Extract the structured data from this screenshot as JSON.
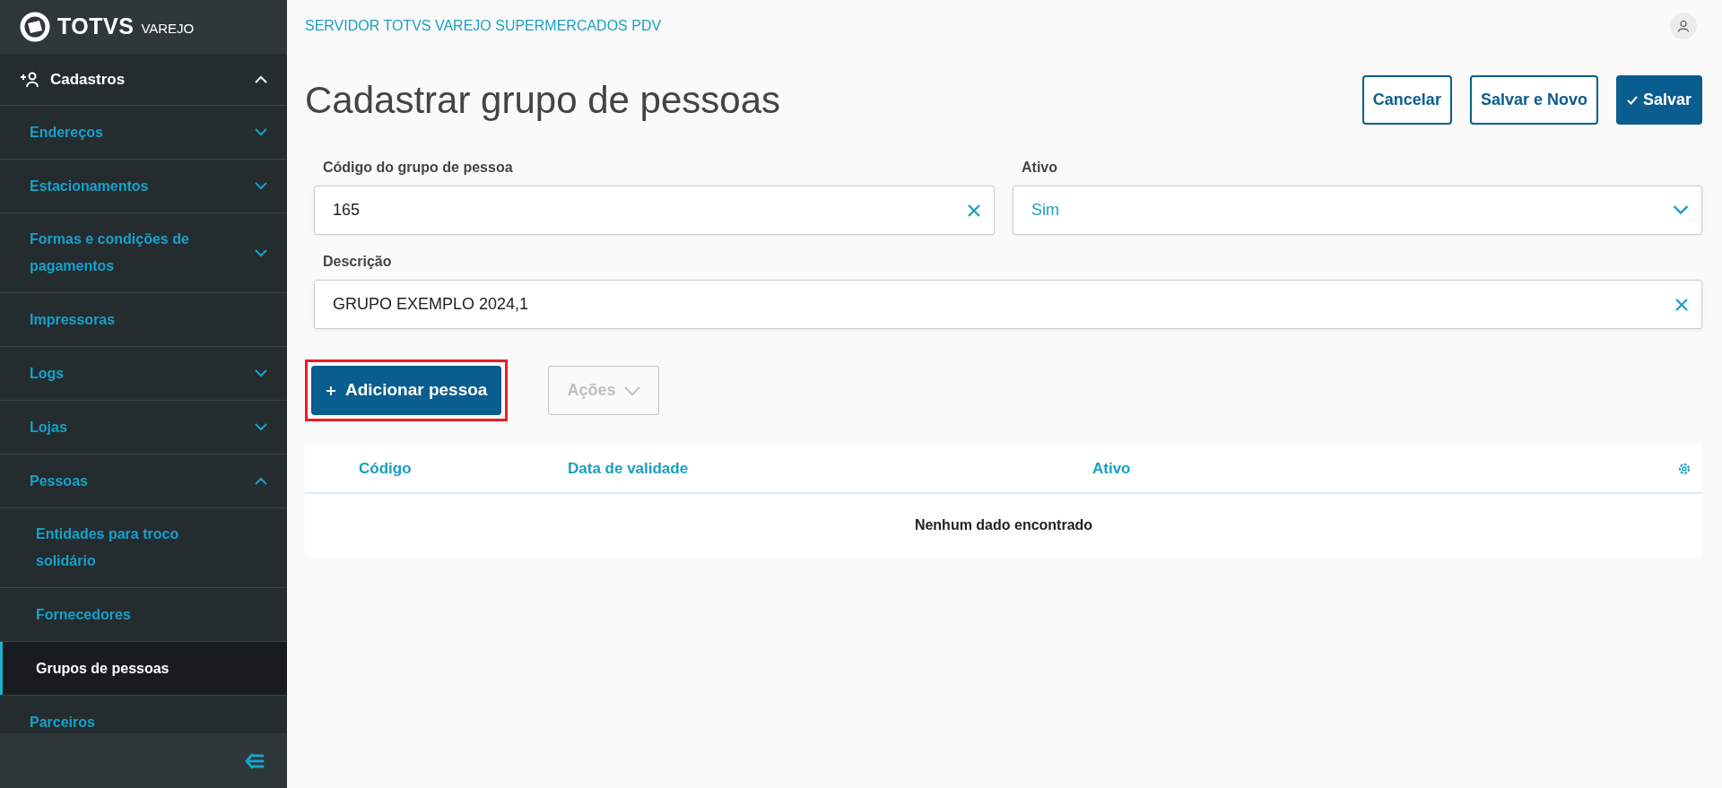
{
  "brand": {
    "name": "TOTVS",
    "product": "VAREJO"
  },
  "sidebar": {
    "section": {
      "label": "Cadastros",
      "expanded": true
    },
    "items": [
      {
        "label": "Endereços",
        "kind": "group",
        "expanded": false,
        "selected": false
      },
      {
        "label": "Estacionamentos",
        "kind": "group",
        "expanded": false,
        "selected": false
      },
      {
        "label": "Formas e condições de pagamentos",
        "kind": "group",
        "expanded": false,
        "selected": false
      },
      {
        "label": "Impressoras",
        "kind": "link",
        "selected": false
      },
      {
        "label": "Logs",
        "kind": "group",
        "expanded": false,
        "selected": false
      },
      {
        "label": "Lojas",
        "kind": "group",
        "expanded": false,
        "selected": false
      },
      {
        "label": "Pessoas",
        "kind": "group",
        "expanded": true,
        "selected": false,
        "children": [
          {
            "label": "Entidades para troco solidário",
            "selected": false
          },
          {
            "label": "Fornecedores",
            "selected": false
          },
          {
            "label": "Grupos de pessoas",
            "selected": true
          }
        ]
      },
      {
        "label": "Parceiros",
        "kind": "link",
        "selected": false
      }
    ]
  },
  "header": {
    "title": "SERVIDOR TOTVS VAREJO SUPERMERCADOS PDV"
  },
  "page": {
    "title": "Cadastrar grupo de pessoas",
    "actions": [
      {
        "label": "Cancelar",
        "kind": "outline"
      },
      {
        "label": "Salvar e Novo",
        "kind": "outline"
      },
      {
        "label": "Salvar",
        "kind": "primary"
      }
    ]
  },
  "form": {
    "fields": [
      {
        "label": "Código do grupo de pessoa",
        "value": "165",
        "kind": "text"
      },
      {
        "label": "Ativo",
        "value": "Sim",
        "kind": "select"
      },
      {
        "label": "Descrição",
        "value": "GRUPO EXEMPLO 2024,1",
        "kind": "text"
      }
    ]
  },
  "toolbar": {
    "add_button": {
      "label": "Adicionar pessoa",
      "highlighted": true
    },
    "actions_button": {
      "label": "Ações",
      "disabled": true
    }
  },
  "table": {
    "columns": [
      "Código",
      "Data de validade",
      "Ativo"
    ],
    "empty_message": "Nenhum dado encontrado"
  }
}
